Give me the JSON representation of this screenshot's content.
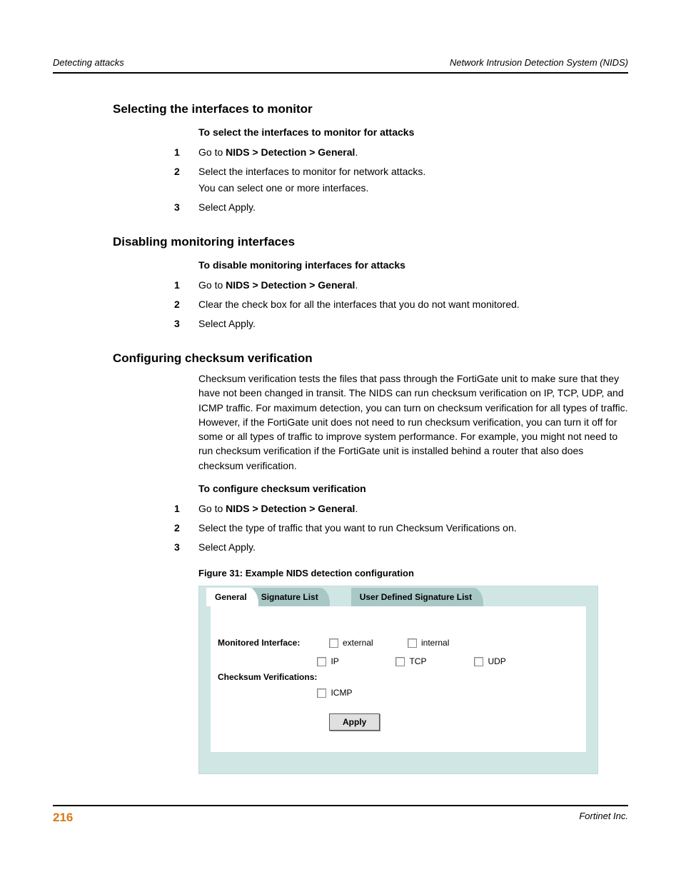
{
  "header": {
    "left": "Detecting attacks",
    "right": "Network Intrusion Detection System (NIDS)"
  },
  "sections": {
    "s1": {
      "title": "Selecting the interfaces to monitor",
      "subhead": "To select the interfaces to monitor for attacks",
      "steps": {
        "n1": "1",
        "t1a": "Go to ",
        "t1b": "NIDS > Detection > General",
        "t1c": ".",
        "n2": "2",
        "t2a": "Select the interfaces to monitor for network attacks.",
        "t2b": "You can select one or more interfaces.",
        "n3": "3",
        "t3": "Select Apply."
      }
    },
    "s2": {
      "title": "Disabling monitoring interfaces",
      "subhead": "To disable monitoring interfaces for attacks",
      "steps": {
        "n1": "1",
        "t1a": "Go to ",
        "t1b": "NIDS > Detection > General",
        "t1c": ".",
        "n2": "2",
        "t2": "Clear the check box for all the interfaces that you do not want monitored.",
        "n3": "3",
        "t3": "Select Apply."
      }
    },
    "s3": {
      "title": "Configuring checksum verification",
      "para": "Checksum verification tests the files that pass through the FortiGate unit to make sure that they have not been changed in transit. The NIDS can run checksum verification on IP, TCP, UDP, and ICMP traffic. For maximum detection, you can turn on checksum verification for all types of traffic. However, if the FortiGate unit does not need to run checksum verification, you can turn it off for some or all types of traffic to improve system performance. For example, you might not need to run checksum verification if the FortiGate unit is installed behind a router that also does checksum verification.",
      "subhead": "To configure checksum verification",
      "steps": {
        "n1": "1",
        "t1a": "Go to ",
        "t1b": "NIDS > Detection > General",
        "t1c": ".",
        "n2": "2",
        "t2": "Select the type of traffic that you want to run Checksum Verifications on.",
        "n3": "3",
        "t3": "Select Apply."
      },
      "fig_caption": "Figure 31: Example NIDS detection configuration"
    }
  },
  "figure": {
    "tabs": {
      "general": "General",
      "siglist": "Signature List",
      "userlist": "User Defined Signature List"
    },
    "labels": {
      "monitored": "Monitored Interface:",
      "checksum": "Checksum Verifications:"
    },
    "checks": {
      "external": "external",
      "internal": "internal",
      "ip": "IP",
      "tcp": "TCP",
      "udp": "UDP",
      "icmp": "ICMP"
    },
    "apply": "Apply"
  },
  "footer": {
    "page": "216",
    "right": "Fortinet Inc."
  }
}
